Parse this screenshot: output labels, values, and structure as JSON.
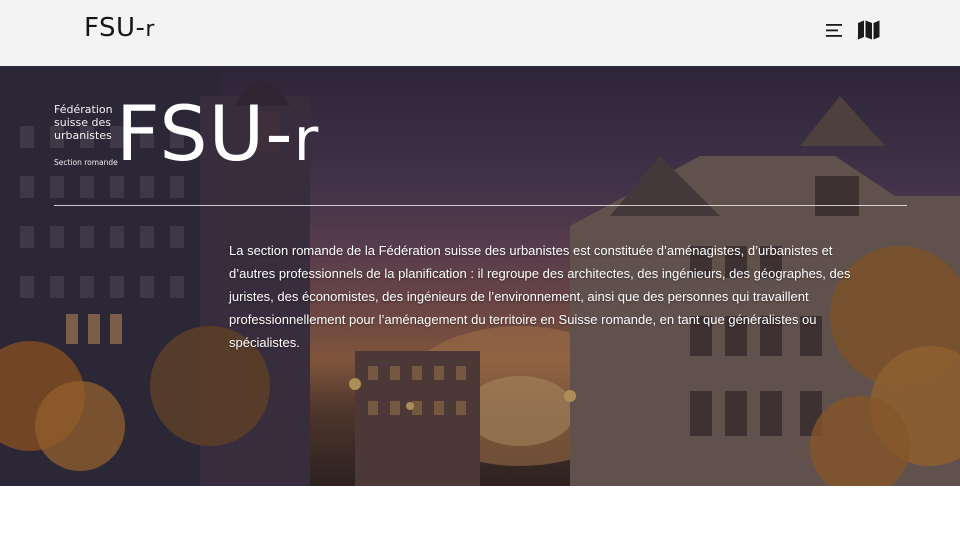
{
  "header": {
    "logo_main": "FSU-",
    "logo_suffix": "r",
    "icons": [
      "hamburger-menu-icon",
      "map-icon"
    ],
    "background": "#f3f3f3"
  },
  "hero": {
    "federation_line1": "Fédération",
    "federation_line2": "suisse des",
    "federation_line3": "urbanistes",
    "section_label": "Section romande",
    "logo_main": "FSU-",
    "logo_suffix": "r",
    "intro_text": "La section romande de la Fédération suisse des urbanistes est constituée d’aménagistes, d’urbanistes et d’autres professionnels de la planification : il regroupe des architectes, des ingénieurs, des géographes, des juristes, des économistes, des ingénieurs de l’environnement, ainsi que des personnes qui travaillent professionnellement pour l’aménagement du territoire en Suisse romande, en tant que généralistes ou spécialistes."
  }
}
